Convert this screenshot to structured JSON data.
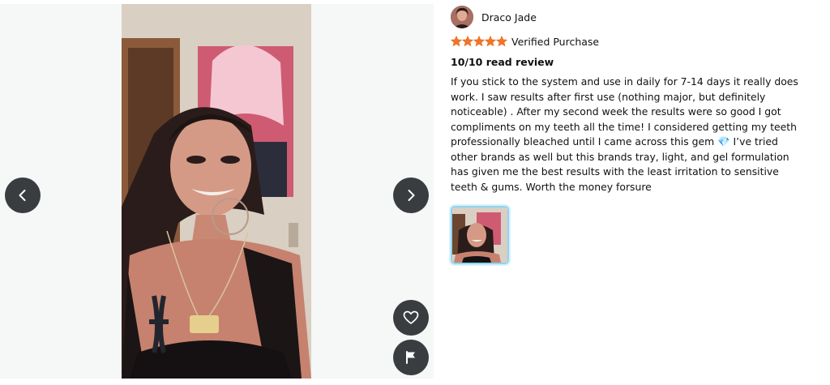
{
  "reviewer": {
    "name": "Draco Jade",
    "avatar_icon": "user-avatar"
  },
  "rating": {
    "value": 5,
    "max": 5,
    "star_color": "#f7712b"
  },
  "badge": "Verified Purchase",
  "title": "10/10 read review",
  "body": {
    "part1": "If you stick to the system and use in daily for 7-14 days it really does work. I saw results after first use (nothing major, but definitely noticeable) . After my second week the results were so good I got compliments on my teeth all the time! I considered getting my teeth professionally bleached until I came across this gem ",
    "emoji": "💎",
    "part2": " I’ve tried other brands as well but this brands tray, light, and gel formulation has given me the best results with the least irritation to sensitive teeth & gums. Worth the money forsure"
  },
  "lightbox": {
    "prev_icon": "chevron-left-icon",
    "next_icon": "chevron-right-icon",
    "like_icon": "heart-icon",
    "report_icon": "flag-icon",
    "button_color": "#3a3d3f",
    "background": "#f6f7f7"
  },
  "thumbnails": [
    {
      "selected": true,
      "border_color": "#8ed4ef"
    }
  ]
}
